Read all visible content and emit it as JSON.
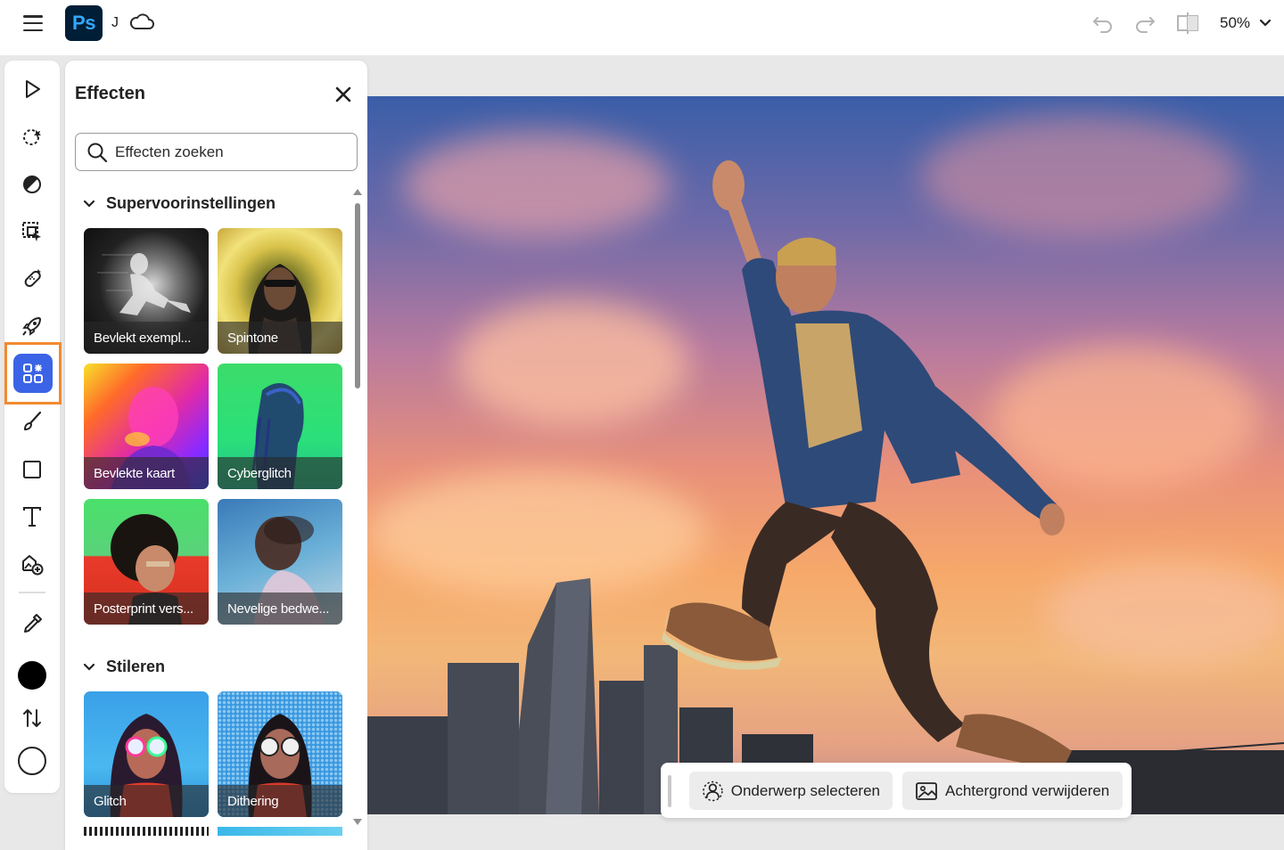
{
  "app": {
    "logo_text": "Ps",
    "doc_initial": "J",
    "zoom_label": "50%"
  },
  "icons": {
    "menu": "hamburger-icon",
    "cloud": "cloud-icon",
    "undo": "undo-icon",
    "redo": "redo-icon",
    "compare": "compare-icon",
    "zoom_dropdown": "chevron-down-icon"
  },
  "toolbar": {
    "tools": [
      {
        "name": "select-tool",
        "icon": "pointer-icon"
      },
      {
        "name": "quick-select-tool",
        "icon": "magic-select-icon"
      },
      {
        "name": "adjust-tool",
        "icon": "adjust-icon"
      },
      {
        "name": "transform-tool",
        "icon": "transform-icon"
      },
      {
        "name": "heal-tool",
        "icon": "bandage-icon"
      },
      {
        "name": "quick-actions-tool",
        "icon": "rocket-icon"
      },
      {
        "name": "effects-tool",
        "icon": "effects-grid-icon",
        "active": true
      },
      {
        "name": "brush-tool",
        "icon": "brush-icon"
      },
      {
        "name": "shape-tool",
        "icon": "square-icon"
      },
      {
        "name": "text-tool",
        "icon": "text-icon"
      },
      {
        "name": "add-image-tool",
        "icon": "add-image-icon"
      },
      {
        "name": "eyedropper-tool",
        "icon": "eyedropper-icon"
      }
    ],
    "foreground_color": "#000000",
    "background_color": "#ffffff",
    "accent": "#3b63e6",
    "highlight": "#f28a30"
  },
  "panel": {
    "title": "Effecten",
    "search_placeholder": "Effecten zoeken",
    "sections": [
      {
        "title": "Supervoorinstellingen",
        "items": [
          "Bevlekt exempl...",
          "Spintone",
          "Bevlekte kaart",
          "Cyberglitch",
          "Posterprint vers...",
          "Nevelige bedwe..."
        ]
      },
      {
        "title": "Stileren",
        "items": [
          "Glitch",
          "Dithering"
        ]
      }
    ]
  },
  "taskbar": {
    "select_subject": "Onderwerp selecteren",
    "remove_background": "Achtergrond verwijderen"
  }
}
